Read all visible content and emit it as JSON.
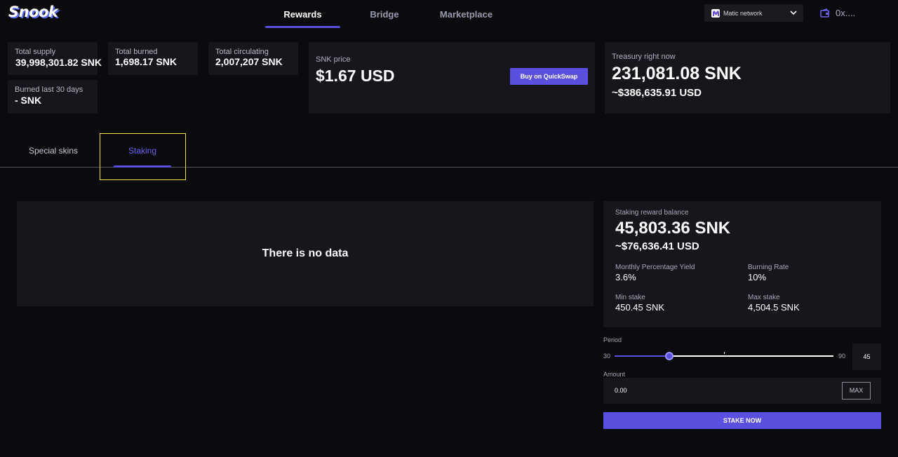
{
  "app": {
    "logo_text": "Snook"
  },
  "nav": {
    "tabs": [
      {
        "label": "Rewards",
        "active": true
      },
      {
        "label": "Bridge",
        "active": false
      },
      {
        "label": "Marketplace",
        "active": false
      }
    ],
    "network": "Matic network",
    "wallet": "0x...."
  },
  "stats": {
    "total_supply": {
      "label": "Total supply",
      "value": "39,998,301.82 SNK"
    },
    "total_burned": {
      "label": "Total burned",
      "value": "1,698.17 SNK"
    },
    "total_circulating": {
      "label": "Total circulating",
      "value": "2,007,207 SNK"
    },
    "burned_30": {
      "label": "Burned last 30 days",
      "value": "- SNK"
    }
  },
  "price": {
    "label": "SNK price",
    "value": "$1.67 USD",
    "buy_label": "Buy on QuickSwap"
  },
  "treasury": {
    "label": "Treasury right now",
    "value": "231,081.08 SNK",
    "usd": "~$386,635.91 USD"
  },
  "tabs": [
    {
      "label": "Special skins",
      "active": false
    },
    {
      "label": "Staking",
      "active": true
    }
  ],
  "empty_state": "There is no data",
  "staking": {
    "balance_label": "Staking reward balance",
    "balance_value": "45,803.36 SNK",
    "balance_usd": "~$76,636.41 USD",
    "mpy_label": "Monthly Percentage Yield",
    "mpy_value": "3.6%",
    "burn_label": "Burning Rate",
    "burn_value": "10%",
    "min_label": "Min stake",
    "min_value": "450.45 SNK",
    "max_label": "Max stake",
    "max_value": "4,504.5 SNK",
    "period_label": "Period",
    "period_min": "30",
    "period_max": "90",
    "period_value": "45",
    "amount_label": "Amount",
    "amount_value": "0.00",
    "max_button": "MAX",
    "stake_button": "STAKE NOW"
  },
  "colors": {
    "accent": "#5b4fe0",
    "background": "#0b0b0d",
    "card": "#16161b",
    "highlight": "#f3e24c"
  }
}
